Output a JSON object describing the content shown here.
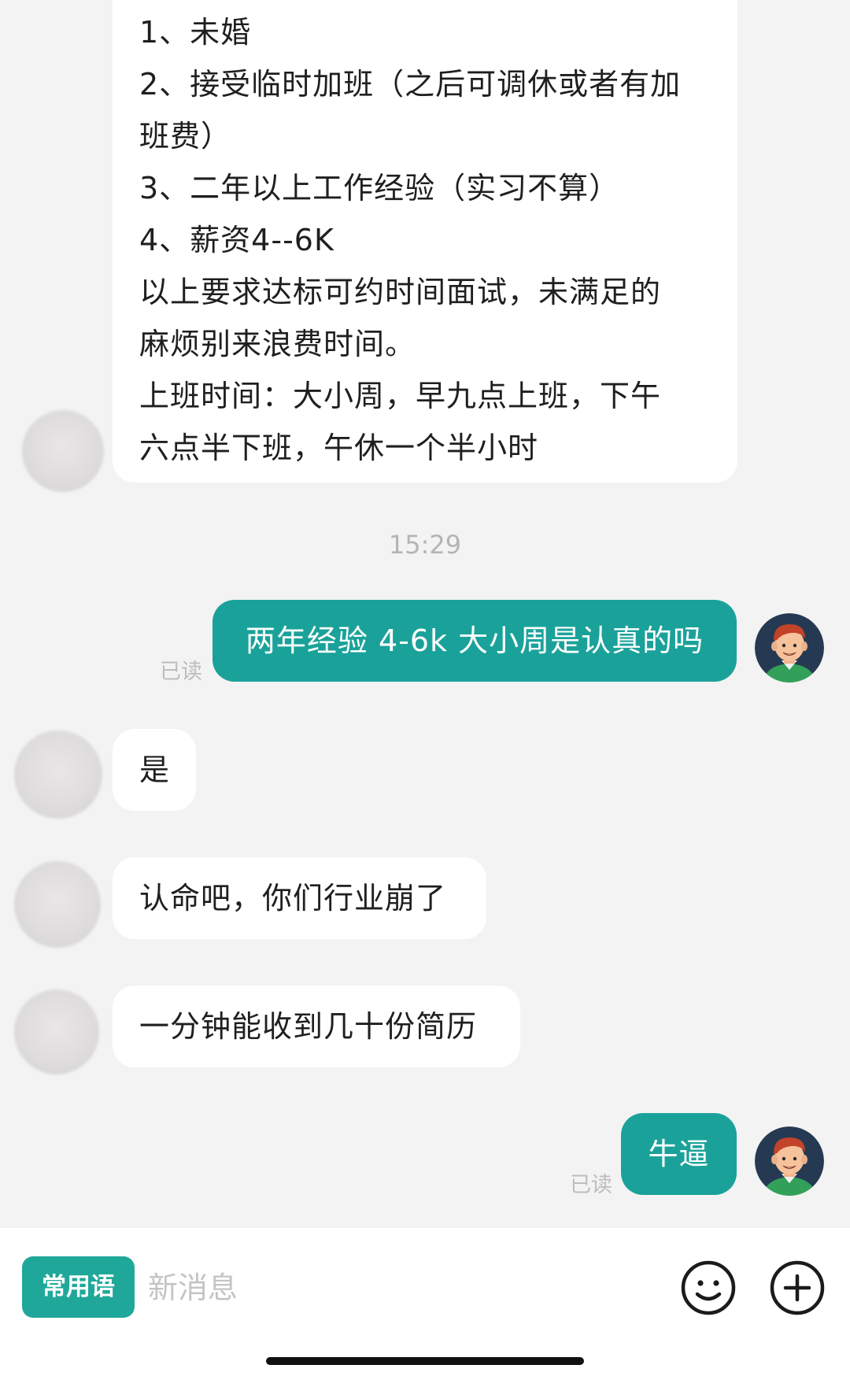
{
  "messages": {
    "first": {
      "lines": [
        "1、未婚",
        "2、接受临时加班（之后可调休或者有加",
        "班费）",
        "3、二年以上工作经验（实习不算）",
        "4、薪资4--6K",
        "以上要求达标可约时间面试，未满足的",
        "麻烦别来浪费时间。",
        "上班时间：大小周，早九点上班，下午",
        "六点半下班，午休一个半小时"
      ]
    },
    "timestamp": "15:29",
    "out1": {
      "text": "两年经验 4-6k 大小周是认真的吗",
      "status": "已读"
    },
    "in1": "是",
    "in2": "认命吧，你们行业崩了",
    "in3": "一分钟能收到几十份简历",
    "out2": {
      "text": "牛逼",
      "status": "已读"
    }
  },
  "input_bar": {
    "quick_phrases_label": "常用语",
    "placeholder": "新消息",
    "emoji_icon": "smiley-face-icon",
    "add_icon": "plus-circle-icon"
  },
  "colors": {
    "outgoing_bubble": "#1aa29a",
    "quick_button": "#1fa89a",
    "background": "#f3f3f3"
  }
}
